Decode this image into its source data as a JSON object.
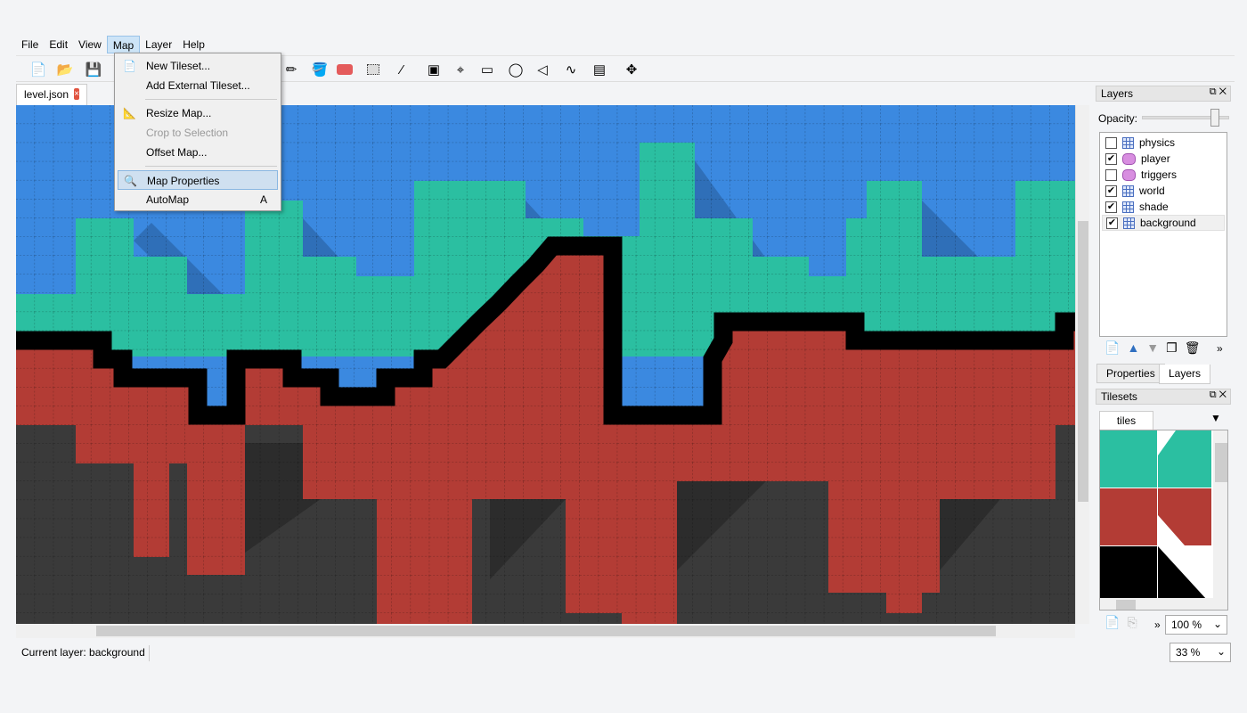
{
  "menubar": {
    "items": [
      "File",
      "Edit",
      "View",
      "Map",
      "Layer",
      "Help"
    ],
    "open": "Map"
  },
  "map_menu": {
    "items": [
      {
        "label": "New Tileset...",
        "icon": "new-tileset-icon",
        "enabled": true
      },
      {
        "label": "Add External Tileset...",
        "enabled": true
      },
      {
        "label": "Resize Map...",
        "icon": "resize-map-icon",
        "enabled": true
      },
      {
        "label": "Crop to Selection",
        "enabled": false
      },
      {
        "label": "Offset Map...",
        "enabled": true
      },
      {
        "label": "Map Properties",
        "icon": "map-properties-icon",
        "enabled": true,
        "highlighted": true
      },
      {
        "label": "AutoMap",
        "shortcut": "A",
        "enabled": true
      }
    ]
  },
  "document_tab": {
    "label": "level.json",
    "close": "×"
  },
  "layers_panel": {
    "title": "Layers",
    "opacity_label": "Opacity:",
    "opacity": 1.0,
    "layers": [
      {
        "name": "physics",
        "type": "tile",
        "visible": false,
        "check": ""
      },
      {
        "name": "player",
        "type": "object",
        "visible": true,
        "check": "✔"
      },
      {
        "name": "triggers",
        "type": "object",
        "visible": false,
        "check": ""
      },
      {
        "name": "world",
        "type": "tile",
        "visible": true,
        "check": "✔"
      },
      {
        "name": "shade",
        "type": "tile",
        "visible": true,
        "check": "✔"
      },
      {
        "name": "background",
        "type": "tile",
        "visible": true,
        "selected": true,
        "check": "✔"
      }
    ],
    "more": "»"
  },
  "panel_tabs": [
    "Properties",
    "Layers"
  ],
  "tilesets_panel": {
    "title": "Tilesets",
    "tab": "tiles",
    "zoom": "100 %",
    "more": "»"
  },
  "map_zoom": "33 %",
  "status": {
    "current_layer": "Current layer: background"
  },
  "colors": {
    "sky": "#3b89e0",
    "grass": "#2bbfa1",
    "dirt": "#b33c35",
    "rock": "#3a3a3a",
    "outline": "#000000"
  }
}
